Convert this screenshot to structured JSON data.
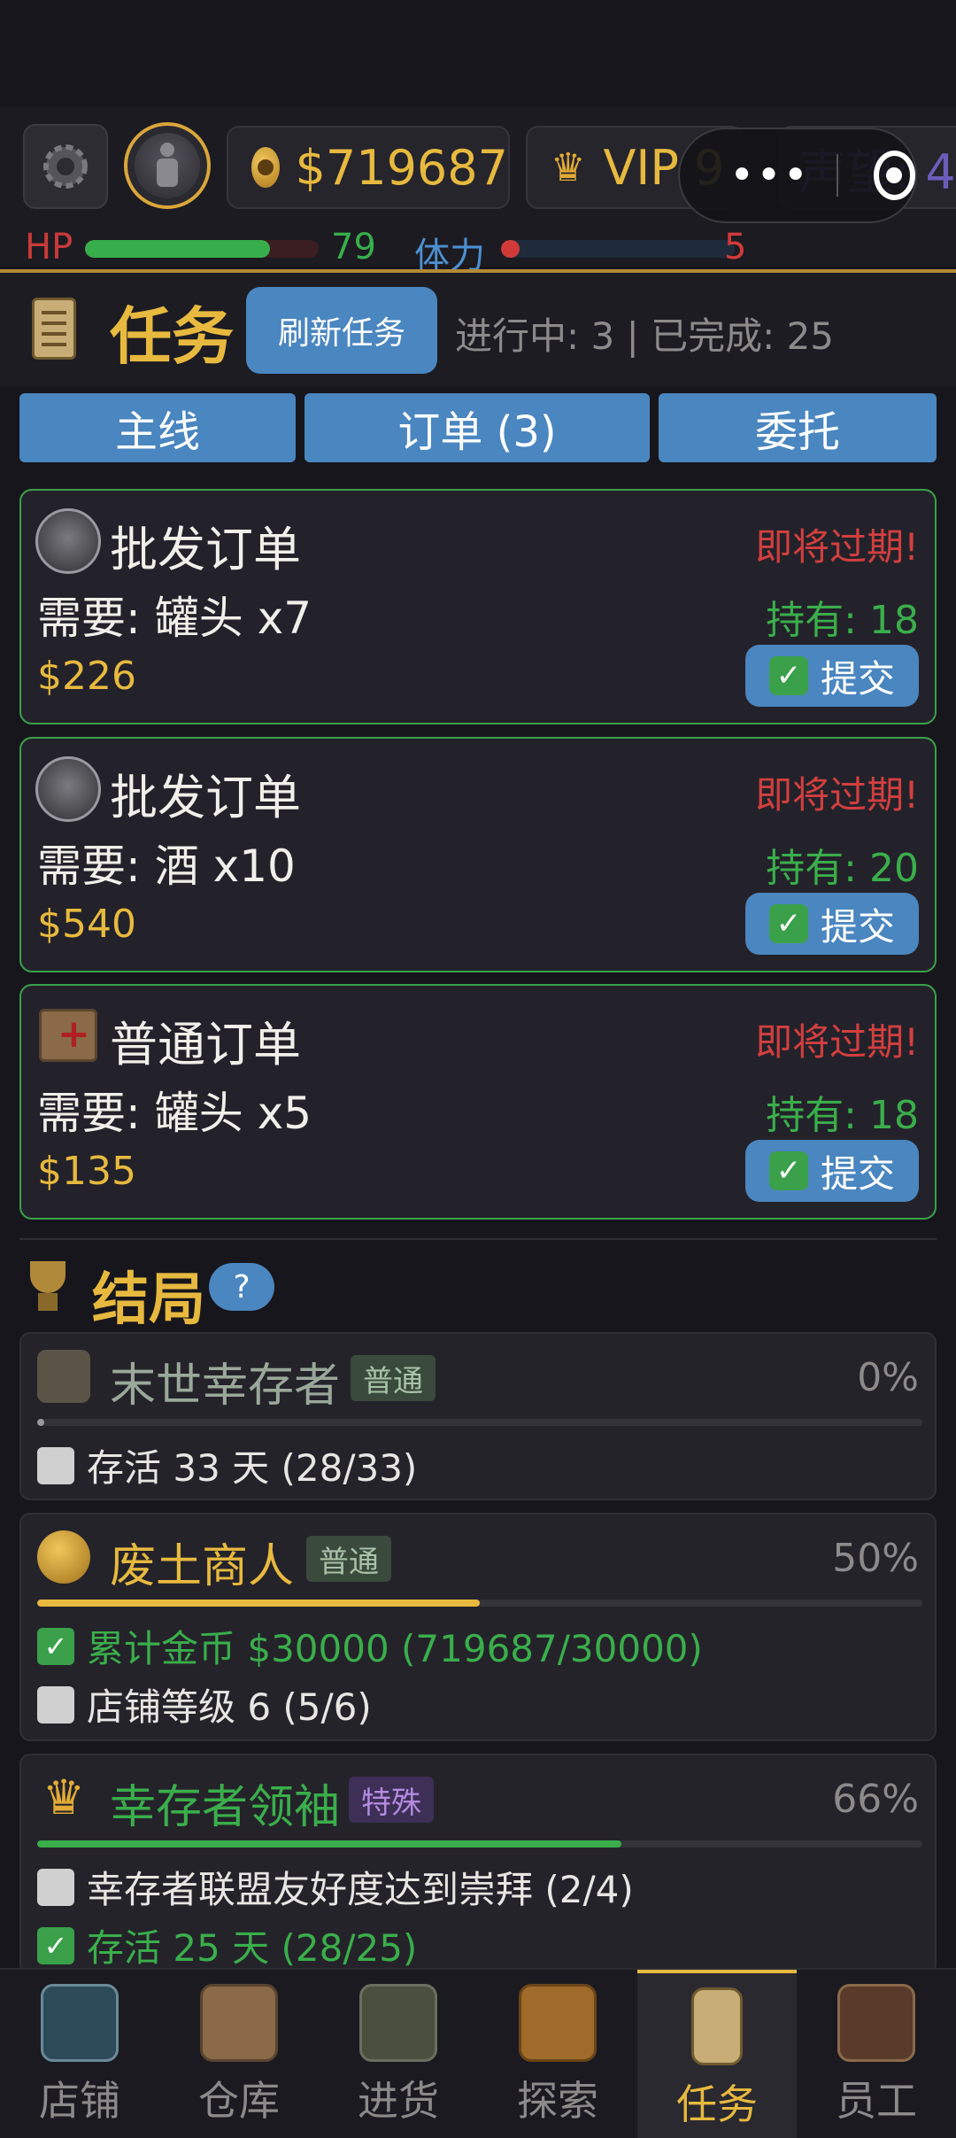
{
  "header": {
    "money": "$719687",
    "vip": "VIP 9",
    "reputation": "声望: 4",
    "hp_label": "HP",
    "hp_value": "79",
    "hp_fill": 0.79,
    "stamina_label": "体力",
    "stamina_value": "5",
    "stamina_fill": 0.05,
    "menu_dots": "•••"
  },
  "task_section": {
    "title": "任务",
    "refresh_button": "刷新任务",
    "progress_info": "进行中: 3 | 已完成: 25"
  },
  "tabs": [
    {
      "label": "主线"
    },
    {
      "label": "订单 (3)"
    },
    {
      "label": "委托"
    }
  ],
  "orders": [
    {
      "title": "批发订单",
      "status": "即将过期!",
      "need": "需要: 罐头 x7",
      "have": "持有: 18",
      "reward": "$226",
      "submit": "提交",
      "icon": "cart-icon"
    },
    {
      "title": "批发订单",
      "status": "即将过期!",
      "need": "需要: 酒 x10",
      "have": "持有: 20",
      "reward": "$540",
      "submit": "提交",
      "icon": "cart-icon"
    },
    {
      "title": "普通订单",
      "status": "即将过期!",
      "need": "需要: 罐头 x5",
      "have": "持有: 18",
      "reward": "$135",
      "submit": "提交",
      "icon": "crate-icon"
    }
  ],
  "endings": {
    "title": "结局",
    "help": "?",
    "items": [
      {
        "name": "末世幸存者",
        "tag": "普通",
        "percent": "0%",
        "progress": 0,
        "name_color": "#9aa89a",
        "bar_color": "#9a9aa0",
        "requirements": [
          {
            "text": "存活 33 天 (28/33)",
            "done": false
          }
        ]
      },
      {
        "name": "废土商人",
        "tag": "普通",
        "percent": "50%",
        "progress": 0.5,
        "name_color": "#e7b93e",
        "bar_color": "#e7b93e",
        "requirements": [
          {
            "text": "累计金币 $30000 (719687/30000)",
            "done": true
          },
          {
            "text": "店铺等级 6 (5/6)",
            "done": false
          }
        ]
      },
      {
        "name": "幸存者领袖",
        "tag": "特殊",
        "percent": "66%",
        "progress": 0.66,
        "name_color": "#3aae4b",
        "bar_color": "#3aae4b",
        "requirements": [
          {
            "text": "幸存者联盟友好度达到崇拜 (2/4)",
            "done": false
          },
          {
            "text": "存活 25 天 (28/25)",
            "done": true
          }
        ]
      }
    ]
  },
  "nav": [
    {
      "label": "店铺",
      "icon": "shop-icon",
      "active": false
    },
    {
      "label": "仓库",
      "icon": "warehouse-icon",
      "active": false
    },
    {
      "label": "进货",
      "icon": "truck-icon",
      "active": false
    },
    {
      "label": "探索",
      "icon": "map-icon",
      "active": false
    },
    {
      "label": "任务",
      "icon": "task-scroll-icon",
      "active": true
    },
    {
      "label": "员工",
      "icon": "staff-icon",
      "active": false
    }
  ]
}
